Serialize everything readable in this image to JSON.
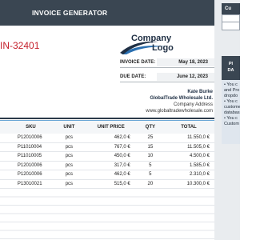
{
  "header": {
    "title": "INVOICE GENERATOR"
  },
  "side_panel": {
    "header_cell": "Cu",
    "button_lines": [
      "PI",
      "DA"
    ],
    "info_lines": [
      "• You c",
      "and Pro",
      "dropdo",
      "• You c",
      "custome",
      "databas",
      "• You c",
      "Custom"
    ]
  },
  "invoice": {
    "number": "IN-32401",
    "invoice_date_label": "INVOICE DATE:",
    "invoice_date": "May 18, 2023",
    "due_date_label": "DUE DATE:",
    "due_date": "June 12, 2023"
  },
  "logo": {
    "line1": "Company",
    "line2": "Logo"
  },
  "customer": {
    "name": "Kate Burke",
    "company": "GlobalTrade Wholesale Ltd.",
    "address": "Company Address",
    "website": "www.globaltradewholesale.com"
  },
  "table": {
    "headers": {
      "sku": "SKU",
      "unit": "UNIT",
      "unit_price": "UNIT PRICE",
      "qty": "QTY",
      "total": "TOTAL"
    },
    "rows": [
      {
        "sku": "P12010006",
        "unit": "pcs",
        "unit_price": "462,0 €",
        "qty": "25",
        "total": "11.550,0 €"
      },
      {
        "sku": "P11010004",
        "unit": "pcs",
        "unit_price": "767,0 €",
        "qty": "15",
        "total": "11.505,0 €"
      },
      {
        "sku": "P11010005",
        "unit": "pcs",
        "unit_price": "450,0 €",
        "qty": "10",
        "total": "4.500,0 €"
      },
      {
        "sku": "P12010006",
        "unit": "pcs",
        "unit_price": "317,0 €",
        "qty": "5",
        "total": "1.585,0 €"
      },
      {
        "sku": "P12010006",
        "unit": "pcs",
        "unit_price": "462,0 €",
        "qty": "5",
        "total": "2.310,0 €"
      },
      {
        "sku": "P13010021",
        "unit": "pcs",
        "unit_price": "515,0 €",
        "qty": "20",
        "total": "10.300,0 €"
      }
    ]
  },
  "colors": {
    "header_bg": "#3a4652",
    "invoice_number": "#c41e2a",
    "accent_blue": "#6aa7d6"
  }
}
